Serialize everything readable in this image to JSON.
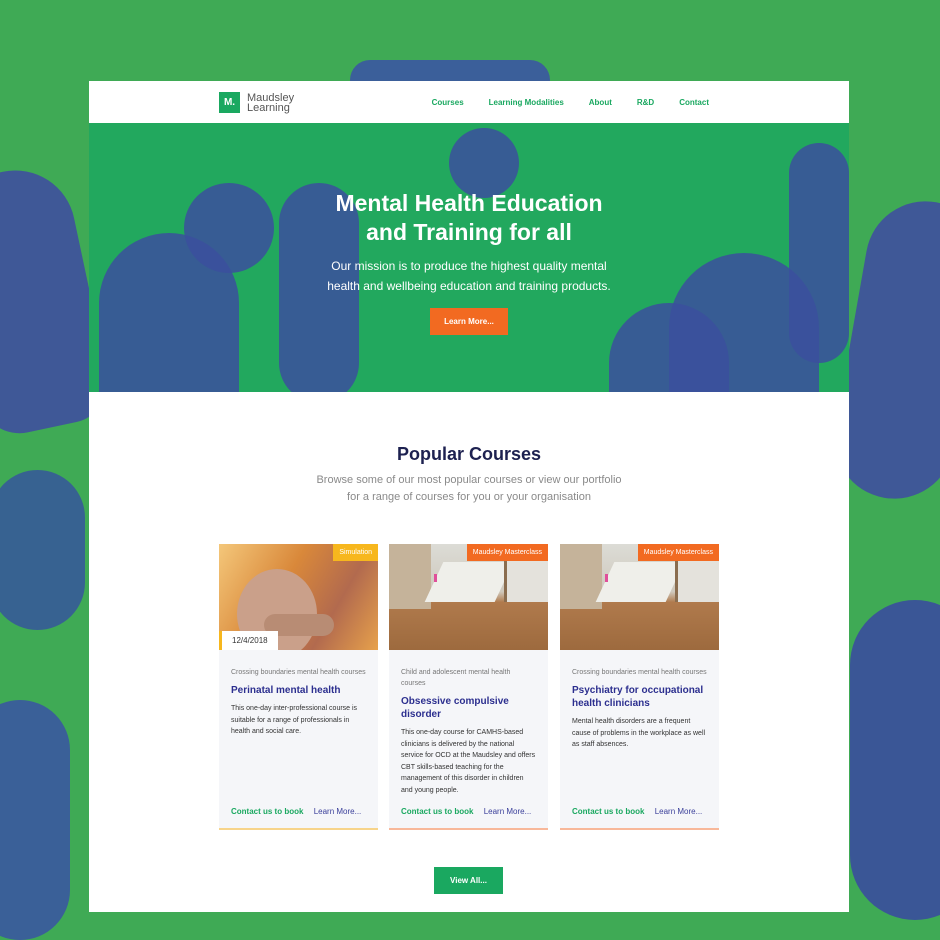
{
  "brand": {
    "logo_mark": "M.",
    "name_line1": "Maudsley",
    "name_line2": "Learning"
  },
  "nav": {
    "items": [
      "Courses",
      "Learning Modalities",
      "About",
      "R&D",
      "Contact"
    ]
  },
  "hero": {
    "title_line1": "Mental Health Education",
    "title_line2": "and Training for all",
    "subtitle_line1": "Our mission is to produce the highest quality mental",
    "subtitle_line2": "health and wellbeing education and training products.",
    "button": "Learn More..."
  },
  "popular": {
    "title": "Popular Courses",
    "subtitle_line1": "Browse some of our most popular courses or view our portfolio",
    "subtitle_line2": "for a range of courses for you or your organisation",
    "view_all": "View All..."
  },
  "cards": [
    {
      "tag": "Simulation",
      "date": "12/4/2018",
      "category": "Crossing boundaries mental health courses",
      "title": "Perinatal mental health",
      "description": "This one-day inter-professional course is suitable for a range of professionals in health and social care.",
      "book": "Contact us to book",
      "more": "Learn More..."
    },
    {
      "tag": "Maudsley Masterclass",
      "category": "Child and adolescent mental health courses",
      "title": "Obsessive compulsive disorder",
      "description": "This one-day course for CAMHS-based clinicians is delivered by the national service for OCD at the Maudsley and offers CBT skills-based teaching for the management of this disorder in children and young people.",
      "book": "Contact us to book",
      "more": "Learn More..."
    },
    {
      "tag": "Maudsley Masterclass",
      "category": "Crossing boundaries mental health courses",
      "title": "Psychiatry for occupational health clinicians",
      "description": "Mental health disorders are a frequent cause of problems in the workplace as well as staff absences.",
      "book": "Contact us to book",
      "more": "Learn More..."
    }
  ],
  "colors": {
    "brand_green": "#1aa860",
    "accent_orange": "#f26a21",
    "accent_yellow": "#f7b71d",
    "navy": "#1d2150"
  }
}
